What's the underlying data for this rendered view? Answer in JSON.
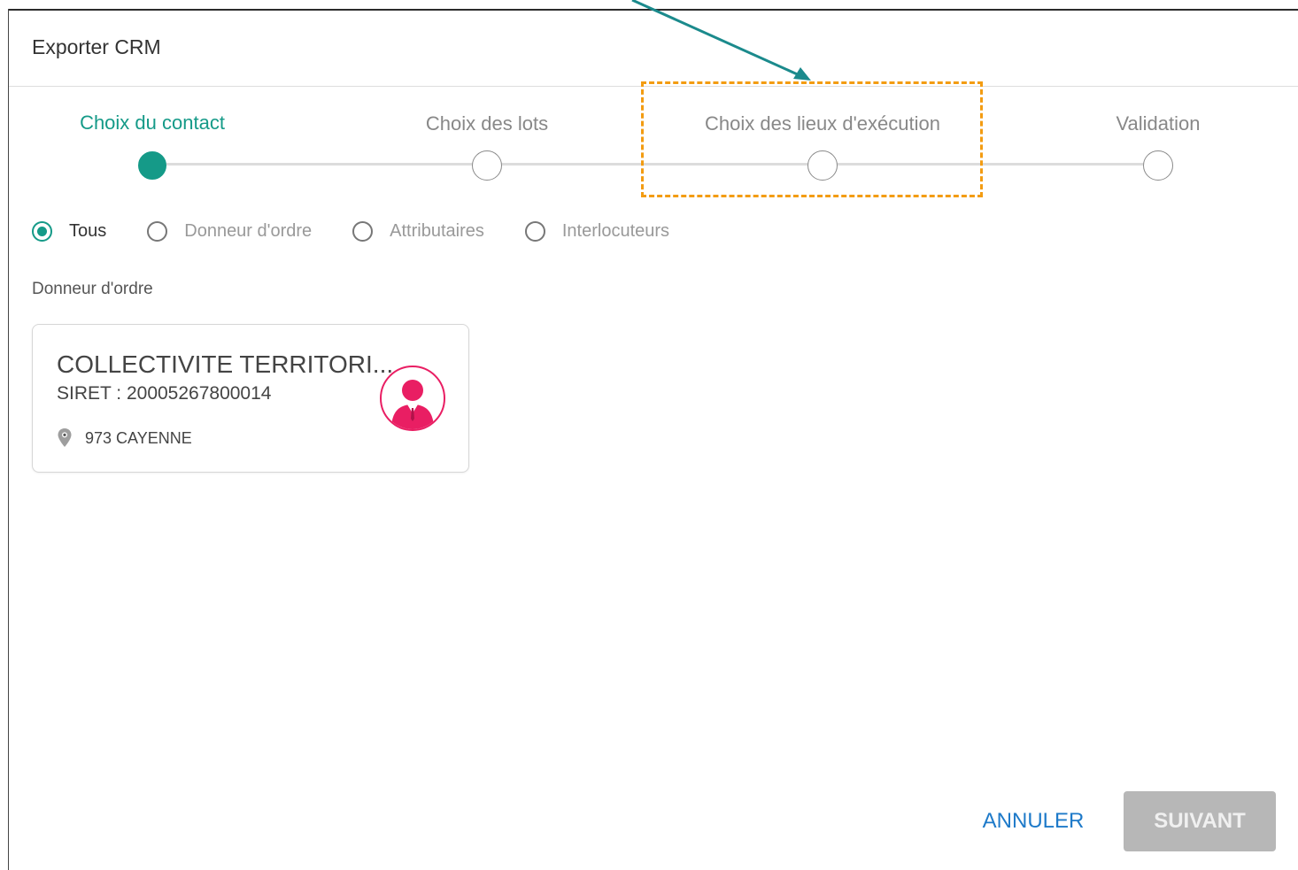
{
  "dialog": {
    "title": "Exporter CRM"
  },
  "stepper": {
    "steps": [
      {
        "label": "Choix du contact",
        "active": true
      },
      {
        "label": "Choix des lots",
        "active": false
      },
      {
        "label": "Choix des lieux d'exécution",
        "active": false
      },
      {
        "label": "Validation",
        "active": false
      }
    ]
  },
  "filter": {
    "options": [
      {
        "label": "Tous",
        "checked": true
      },
      {
        "label": "Donneur d'ordre",
        "checked": false
      },
      {
        "label": "Attributaires",
        "checked": false
      },
      {
        "label": "Interlocuteurs",
        "checked": false
      }
    ]
  },
  "section": {
    "label": "Donneur d'ordre"
  },
  "card": {
    "name": "COLLECTIVITE TERRITORI...",
    "siret": "SIRET : 20005267800014",
    "location": "973 CAYENNE"
  },
  "actions": {
    "cancel_label": "ANNULER",
    "next_label": "SUIVANT"
  },
  "colors": {
    "accent": "#159a88",
    "highlight": "#f39c12",
    "avatar": "#e91e63",
    "link": "#1e7ac9"
  }
}
